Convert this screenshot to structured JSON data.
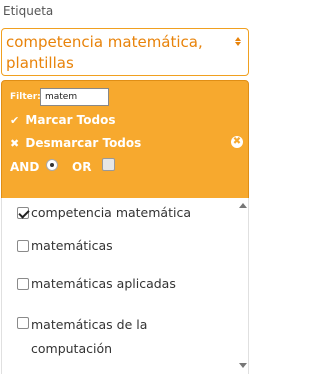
{
  "field": {
    "label": "Etiqueta"
  },
  "select": {
    "value": "competencia matemática, plantillas"
  },
  "filter": {
    "label": "Filter:",
    "value": "matem",
    "select_all_glyph": "✔",
    "select_all_label": "Marcar Todos",
    "deselect_all_glyph": "✖",
    "deselect_all_label": "Desmarcar Todos",
    "and_label": "AND",
    "or_label": "OR",
    "and_selected": true,
    "or_checked": false,
    "clear_glyph": "✖"
  },
  "options": [
    {
      "label": "competencia matemática",
      "checked": true
    },
    {
      "label": "matemáticas",
      "checked": false
    },
    {
      "label": "matemáticas aplicadas",
      "checked": false
    },
    {
      "label": "matemáticas de la computación",
      "checked": false
    }
  ],
  "colors": {
    "accent": "#f7a92e",
    "accent_text": "#e8830a",
    "header_border": "#e08e15"
  },
  "icons": {
    "select_arrows": "up-down-caret-icon",
    "clear": "close-circle-icon",
    "scroll_up": "scroll-up-arrow-icon",
    "scroll_down": "scroll-down-arrow-icon"
  }
}
